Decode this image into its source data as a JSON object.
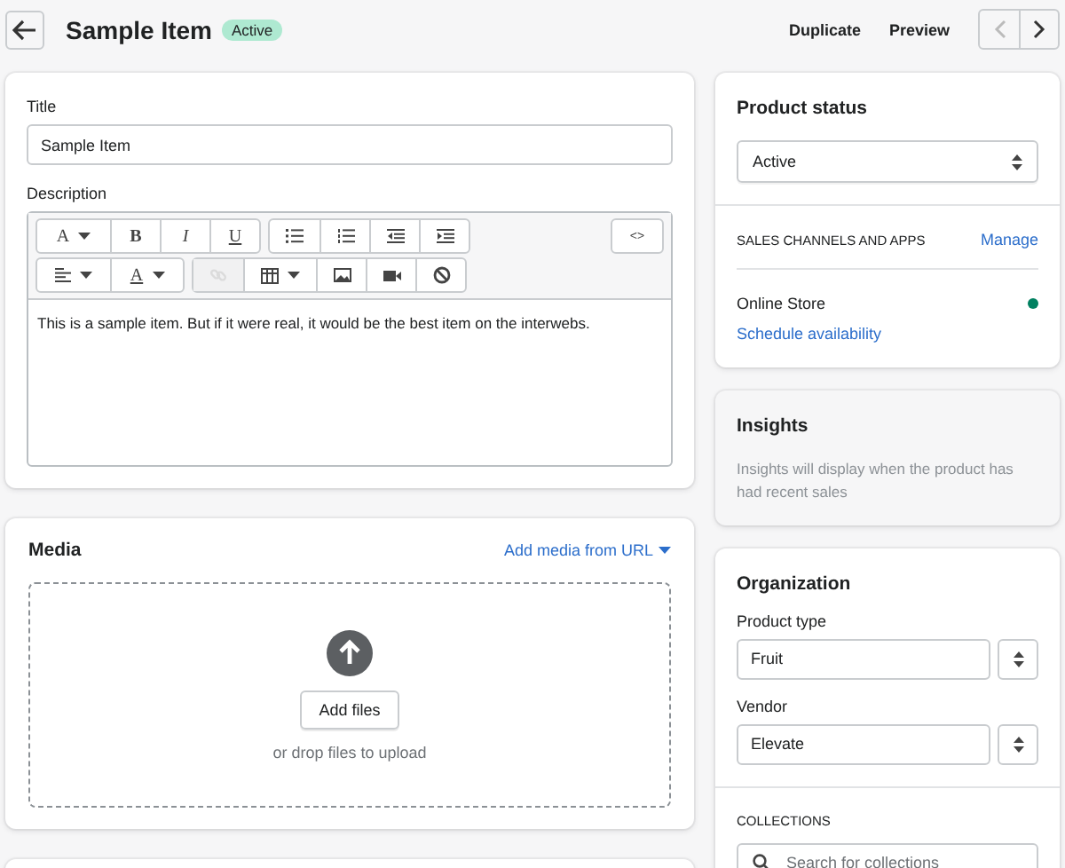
{
  "header": {
    "title": "Sample Item",
    "badge": "Active",
    "actions": [
      "Duplicate",
      "Preview"
    ],
    "pager": [
      {
        "kind": "prev",
        "disabled": true
      },
      {
        "kind": "next",
        "disabled": false
      }
    ]
  },
  "details": {
    "title_label": "Title",
    "title_value": "Sample Item",
    "description_label": "Description",
    "toolbar": [
      [
        [
          {
            "kind": "font",
            "label": "A",
            "caret": true,
            "disabled": false
          },
          {
            "kind": "bold",
            "label": "B",
            "caret": false,
            "disabled": false
          },
          {
            "kind": "italic",
            "label": "I",
            "caret": false,
            "disabled": false
          },
          {
            "kind": "underline",
            "label": "U",
            "caret": false,
            "disabled": false
          }
        ],
        [
          {
            "kind": "bullets",
            "caret": false,
            "disabled": false
          },
          {
            "kind": "numbers",
            "caret": false,
            "disabled": false
          },
          {
            "kind": "outdent",
            "caret": false,
            "disabled": false
          },
          {
            "kind": "indent",
            "caret": false,
            "disabled": false
          }
        ],
        [
          {
            "kind": "code",
            "label": "<>",
            "caret": false,
            "disabled": false
          }
        ]
      ],
      [
        [
          {
            "kind": "align",
            "caret": true,
            "disabled": false
          },
          {
            "kind": "color",
            "label": "A",
            "caret": true,
            "disabled": false
          }
        ],
        [
          {
            "kind": "link",
            "caret": false,
            "disabled": true
          },
          {
            "kind": "table",
            "caret": true,
            "disabled": false
          },
          {
            "kind": "image",
            "caret": false,
            "disabled": false
          },
          {
            "kind": "video",
            "caret": false,
            "disabled": false
          },
          {
            "kind": "clear",
            "caret": false,
            "disabled": false
          }
        ]
      ]
    ],
    "description": "This is a sample item. But if it were real, it would be the best item on the interwebs."
  },
  "media": {
    "title": "Media",
    "url_link": "Add media from URL",
    "button": "Add files",
    "hint": "or drop files to upload"
  },
  "status": {
    "title": "Product status",
    "value": "Active",
    "channels_heading": "SALES CHANNELS AND APPS",
    "manage": "Manage",
    "channels": [
      {
        "name": "Online Store",
        "color": "#008060",
        "link": "Schedule availability"
      }
    ]
  },
  "insights": {
    "title": "Insights",
    "text": "Insights will display when the product has had recent sales"
  },
  "organization": {
    "title": "Organization",
    "fields": [
      {
        "label": "Product type",
        "value": "Fruit"
      },
      {
        "label": "Vendor",
        "value": "Elevate"
      }
    ],
    "collections_heading": "COLLECTIONS",
    "collections_placeholder": "Search for collections"
  }
}
